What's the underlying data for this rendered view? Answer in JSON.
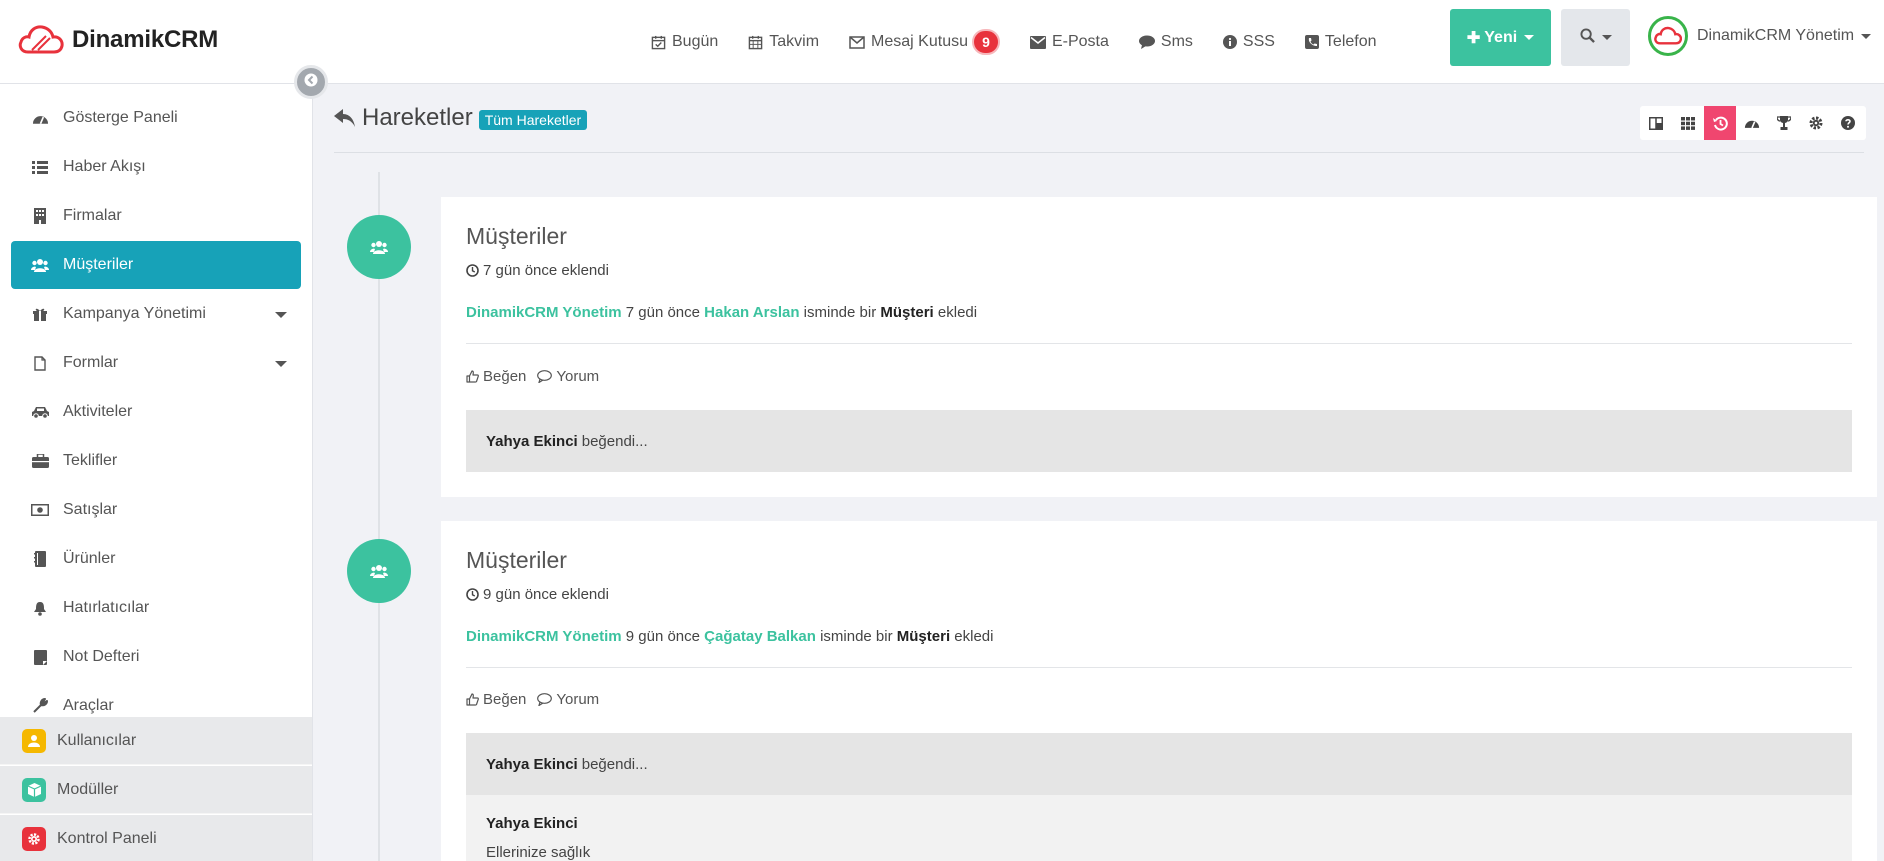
{
  "app": {
    "brand": "DinamikCRM",
    "brand_color": "#e8323c",
    "accent": "#3cc29f",
    "active_color": "#17a2b8"
  },
  "topnav": {
    "items": [
      {
        "label": "Bugün",
        "icon": "calendar-check-icon"
      },
      {
        "label": "Takvim",
        "icon": "calendar-icon"
      },
      {
        "label": "Mesaj Kutusu",
        "icon": "envelope-outline-icon",
        "badge": "9"
      },
      {
        "label": "E-Posta",
        "icon": "envelope-icon"
      },
      {
        "label": "Sms",
        "icon": "comment-icon"
      },
      {
        "label": "SSS",
        "icon": "info-icon"
      },
      {
        "label": "Telefon",
        "icon": "phone-icon"
      }
    ],
    "new_button": "Yeni",
    "user_name": "DinamikCRM Yönetim"
  },
  "sidebar": {
    "items": [
      {
        "label": "Gösterge Paneli",
        "icon": "dashboard-icon"
      },
      {
        "label": "Haber Akışı",
        "icon": "list-icon"
      },
      {
        "label": "Firmalar",
        "icon": "building-icon"
      },
      {
        "label": "Müşteriler",
        "icon": "users-icon",
        "active": true
      },
      {
        "label": "Kampanya Yönetimi",
        "icon": "gift-icon",
        "has_submenu": true
      },
      {
        "label": "Formlar",
        "icon": "file-icon",
        "has_submenu": true
      },
      {
        "label": "Aktiviteler",
        "icon": "car-icon"
      },
      {
        "label": "Teklifler",
        "icon": "briefcase-icon"
      },
      {
        "label": "Satışlar",
        "icon": "money-icon"
      },
      {
        "label": "Ürünler",
        "icon": "book-icon"
      },
      {
        "label": "Hatırlatıcılar",
        "icon": "bell-icon"
      },
      {
        "label": "Not Defteri",
        "icon": "notebook-icon"
      },
      {
        "label": "Araçlar",
        "icon": "wrench-icon"
      }
    ],
    "bottom": [
      {
        "label": "Kullanıcılar",
        "icon": "user-icon",
        "color": "#f5b800"
      },
      {
        "label": "Modüller",
        "icon": "cube-icon",
        "color": "#3cc29f"
      },
      {
        "label": "Kontrol Paneli",
        "icon": "gear-icon",
        "color": "#e8323c"
      }
    ]
  },
  "page": {
    "title": "Hareketler",
    "label": "Tüm Hareketler",
    "toolbar": [
      "layout-icon",
      "grid-icon",
      "history-icon",
      "dashboard-icon",
      "trophy-icon",
      "gear-icon",
      "help-icon"
    ]
  },
  "timeline": [
    {
      "title": "Müşteriler",
      "time": "7 gün önce eklendi",
      "actor": "DinamikCRM Yönetim",
      "when": "7 gün önce",
      "subject": "Hakan Arslan",
      "middle": "isminde bir",
      "type": "Müşteri",
      "verb": "ekledi",
      "like_label": "Beğen",
      "comment_label": "Yorum",
      "liked_by": "Yahya Ekinci",
      "liked_text": "beğendi..."
    },
    {
      "title": "Müşteriler",
      "time": "9 gün önce eklendi",
      "actor": "DinamikCRM Yönetim",
      "when": "9 gün önce",
      "subject": "Çağatay Balkan",
      "middle": "isminde bir",
      "type": "Müşteri",
      "verb": "ekledi",
      "like_label": "Beğen",
      "comment_label": "Yorum",
      "liked_by": "Yahya Ekinci",
      "liked_text": "beğendi...",
      "comment_author": "Yahya Ekinci",
      "comment_text": "Ellerinize sağlık"
    }
  ]
}
